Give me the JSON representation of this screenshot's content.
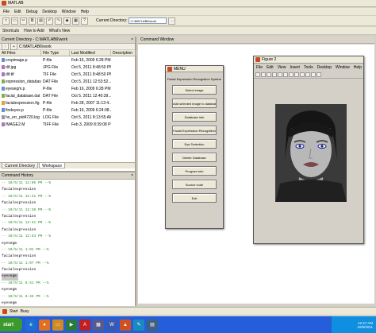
{
  "window": {
    "title": "MATLAB"
  },
  "menubar": [
    "File",
    "Edit",
    "Debug",
    "Desktop",
    "Window",
    "Help"
  ],
  "toolbar": {
    "current_dir_label": "Current Directory:",
    "current_dir_value": "C:\\MATLAB6\\work"
  },
  "shortcuts": {
    "items": [
      "Shortcuts",
      "How to Add",
      "What's New"
    ]
  },
  "current_dir_panel": {
    "title": "Current Directory - C:\\MATLAB6\\work",
    "path": "C:\\MATLAB6\\work",
    "columns": [
      "All Files",
      "File Type",
      "Last Modified",
      "Description"
    ],
    "files": [
      {
        "name": "cropimage.p",
        "type": "P-file",
        "modified": "Feb 16, 2009 6:28 PM",
        "icon": "p"
      },
      {
        "name": "dif.jpg",
        "type": "JPG File",
        "modified": "Oct 5, 2011 8:48:50 PM",
        "icon": "img"
      },
      {
        "name": "dif.tif",
        "type": "TIF File",
        "modified": "Oct 5, 2011 8:48:50 PM",
        "icon": "img"
      },
      {
        "name": "expression_database",
        "type": "DAT File",
        "modified": "Oct 5, 2011 12:53:52...",
        "icon": "mat"
      },
      {
        "name": "eyesegm.p",
        "type": "P-file",
        "modified": "Feb 16, 2009 6:28 PM",
        "icon": "p"
      },
      {
        "name": "facial_database.dat",
        "type": "DAT File",
        "modified": "Oct 5, 2011 12:40:39...",
        "icon": "mat"
      },
      {
        "name": "facialexpression.fig",
        "type": "P-file",
        "modified": "Feb 28, 2007 11:12:4...",
        "icon": "fig"
      },
      {
        "name": "findeyes.p",
        "type": "P-file",
        "modified": "Feb 16, 2009 6:24:08...",
        "icon": "p"
      },
      {
        "name": "hs_err_pid4720.log",
        "type": "LOG File",
        "modified": "Oct 5, 2011 8:13:55 AM",
        "icon": "log"
      },
      {
        "name": "IMAGE2.M",
        "type": "TIFF File",
        "modified": "Feb 3, 2009 8:39:08 PM",
        "icon": "img"
      }
    ],
    "tabs": [
      "Current Directory",
      "Workspace"
    ]
  },
  "history_panel": {
    "title": "Command History",
    "lines": [
      {
        "text": "-- 10/5/11  12:06 PM --%",
        "kind": "sep"
      },
      {
        "text": "  facialexpression",
        "kind": "cmd"
      },
      {
        "text": "-- 10/5/11  12:21 PM --%",
        "kind": "sep"
      },
      {
        "text": "  facialexpression",
        "kind": "cmd"
      },
      {
        "text": "-- 10/5/11  12:38 PM --%",
        "kind": "sep"
      },
      {
        "text": "  facialexpression",
        "kind": "cmd"
      },
      {
        "text": "-- 10/5/11  12:41 PM --%",
        "kind": "sep"
      },
      {
        "text": "  facialexpression",
        "kind": "cmd"
      },
      {
        "text": "-- 10/5/11  12:53 PM --%",
        "kind": "sep"
      },
      {
        "text": "  eyesegm",
        "kind": "cmd"
      },
      {
        "text": "-- 10/5/11  1:01 PM --%",
        "kind": "sep"
      },
      {
        "text": "  facialexpression",
        "kind": "cmd"
      },
      {
        "text": "-- 10/5/11  1:07 PM --%",
        "kind": "sep"
      },
      {
        "text": "  facialexpression",
        "kind": "cmd"
      },
      {
        "text": "  eyesegm",
        "kind": "sel"
      },
      {
        "text": "-- 10/5/11  8:41 PM --%",
        "kind": "sep"
      },
      {
        "text": "  eyesegm",
        "kind": "cmd"
      },
      {
        "text": "-- 10/5/11  8:45 PM --%",
        "kind": "sep"
      },
      {
        "text": "  eyesegm",
        "kind": "cmd"
      }
    ]
  },
  "command_window": {
    "title": "Command Window"
  },
  "menu_window": {
    "title": "MENU",
    "heading": "Facial Expression Recognition System",
    "buttons": [
      "Select image",
      "Add selected image to database",
      "Database info",
      "Facial Expression Recognition",
      "Eye Detection",
      "Delete Database",
      "Program info",
      "Source code",
      "Exit"
    ]
  },
  "figure_window": {
    "title": "Figure 2",
    "menu": [
      "File",
      "Edit",
      "View",
      "Insert",
      "Tools",
      "Desktop",
      "Window",
      "Help"
    ]
  },
  "statusbar": {
    "label": "Start",
    "text": "Busy"
  },
  "taskbar": {
    "start": "start",
    "time": "12:47 AM",
    "date": "10/5/2011"
  },
  "colors": {
    "taskbar": "#245edb",
    "start": "#3c9a2c",
    "tray": "#0f8fe0"
  }
}
